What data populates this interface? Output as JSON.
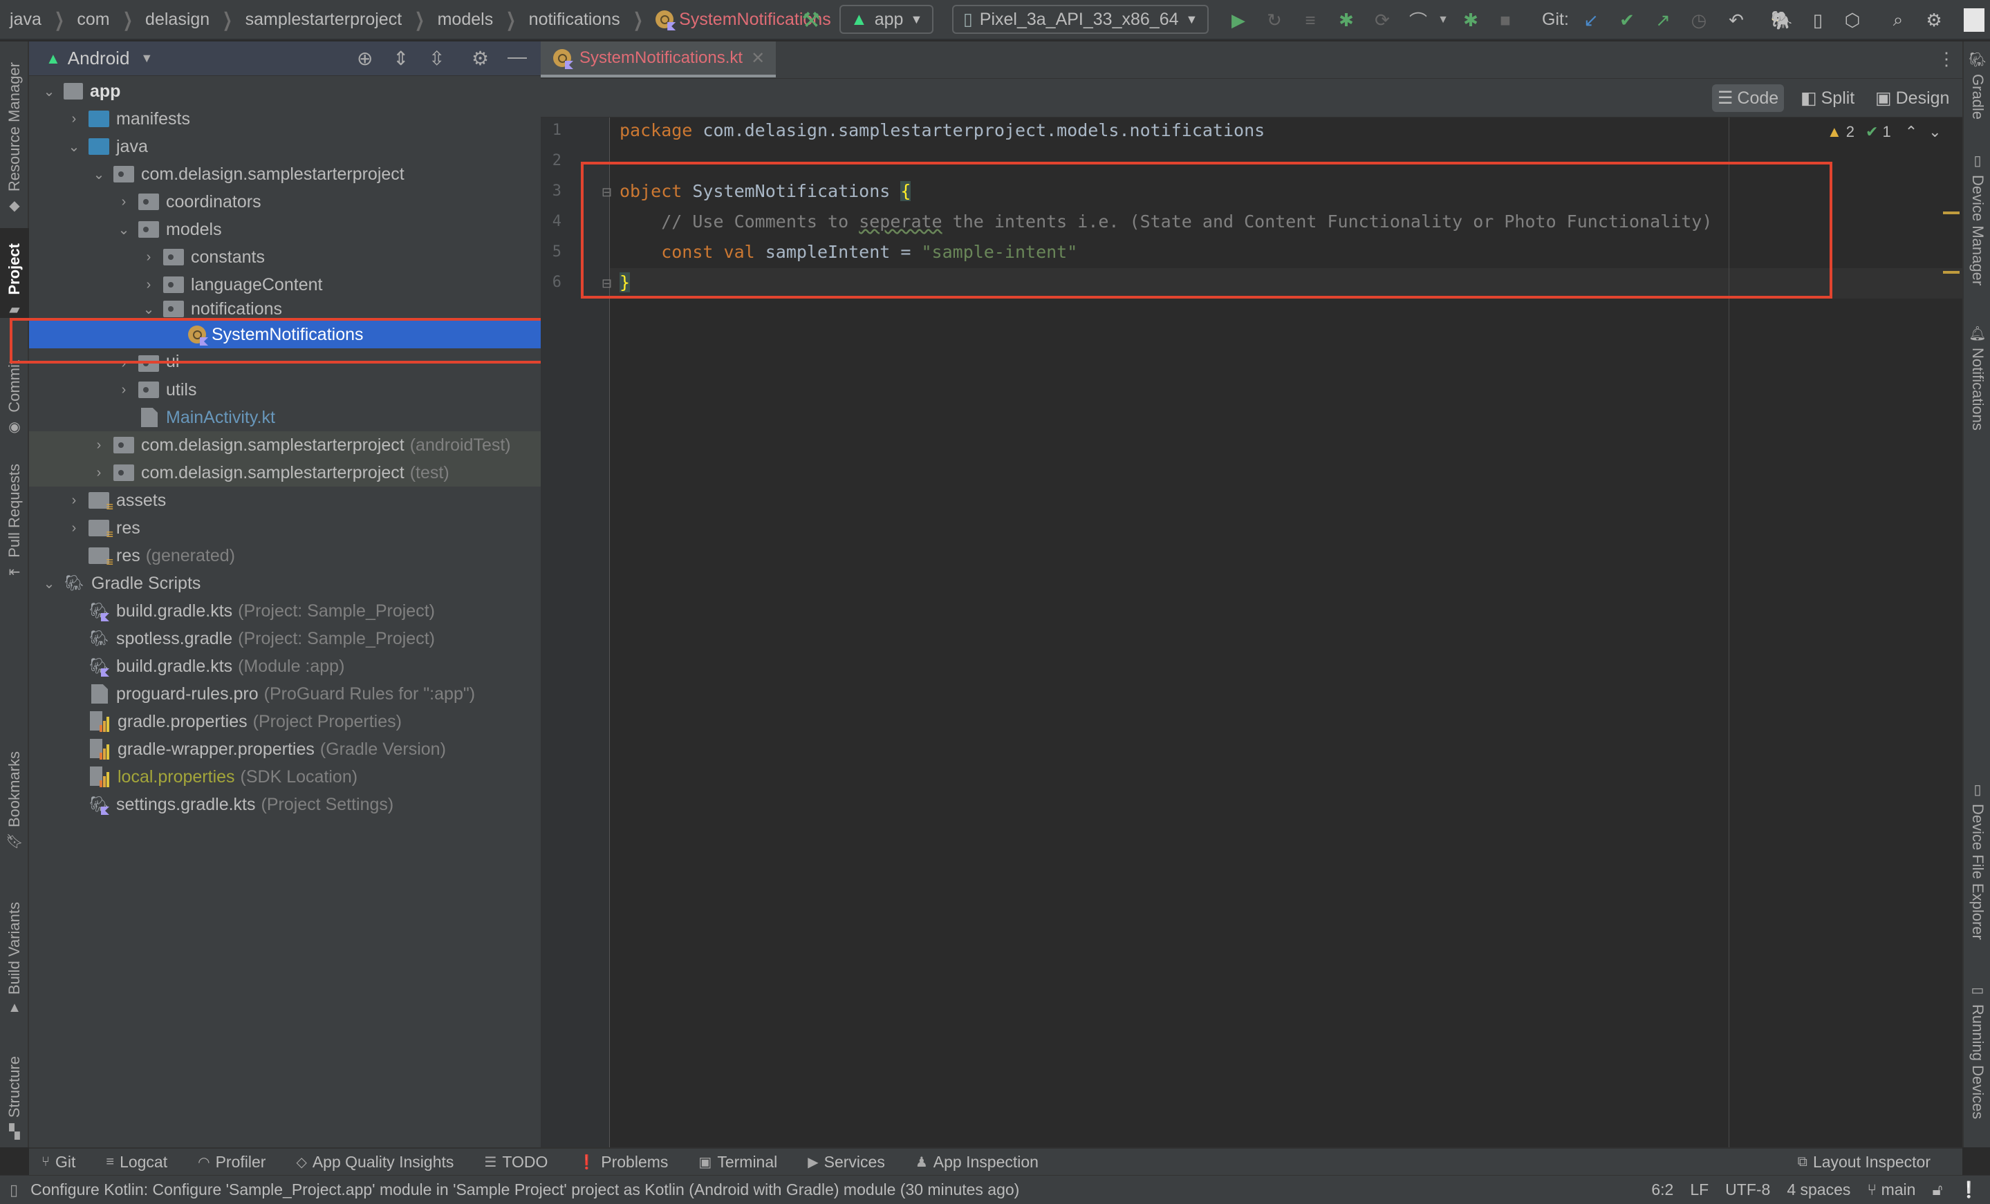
{
  "breadcrumb": {
    "items": [
      "java",
      "com",
      "delasign",
      "samplestarterproject",
      "models",
      "notifications"
    ],
    "current": "SystemNotifications"
  },
  "toolbar": {
    "run_config": "app",
    "device": "Pixel_3a_API_33_x86_64",
    "git_label": "Git:"
  },
  "left_stripe": {
    "tabs": [
      "Resource Manager",
      "Project",
      "Commit",
      "Pull Requests",
      "Bookmarks",
      "Build Variants",
      "Structure"
    ]
  },
  "right_stripe": {
    "tabs": [
      "Gradle",
      "Device Manager",
      "Notifications",
      "Device File Explorer",
      "Running Devices"
    ]
  },
  "project_panel": {
    "view": "Android",
    "tree": [
      {
        "label": "app",
        "hint": ""
      },
      {
        "label": "manifests",
        "hint": ""
      },
      {
        "label": "java",
        "hint": ""
      },
      {
        "label": "com.delasign.samplestarterproject",
        "hint": ""
      },
      {
        "label": "coordinators",
        "hint": ""
      },
      {
        "label": "models",
        "hint": ""
      },
      {
        "label": "constants",
        "hint": ""
      },
      {
        "label": "languageContent",
        "hint": ""
      },
      {
        "label": "notifications",
        "hint": ""
      },
      {
        "label": "SystemNotifications",
        "hint": ""
      },
      {
        "label": "ui",
        "hint": ""
      },
      {
        "label": "utils",
        "hint": ""
      },
      {
        "label": "MainActivity.kt",
        "hint": ""
      },
      {
        "label": "com.delasign.samplestarterproject",
        "hint": "(androidTest)"
      },
      {
        "label": "com.delasign.samplestarterproject",
        "hint": "(test)"
      },
      {
        "label": "assets",
        "hint": ""
      },
      {
        "label": "res",
        "hint": ""
      },
      {
        "label": "res",
        "hint": "(generated)"
      },
      {
        "label": "Gradle Scripts",
        "hint": ""
      },
      {
        "label": "build.gradle.kts",
        "hint": "(Project: Sample_Project)"
      },
      {
        "label": "spotless.gradle",
        "hint": "(Project: Sample_Project)"
      },
      {
        "label": "build.gradle.kts",
        "hint": "(Module :app)"
      },
      {
        "label": "proguard-rules.pro",
        "hint": "(ProGuard Rules for \":app\")"
      },
      {
        "label": "gradle.properties",
        "hint": "(Project Properties)"
      },
      {
        "label": "gradle-wrapper.properties",
        "hint": "(Gradle Version)"
      },
      {
        "label": "local.properties",
        "hint": "(SDK Location)"
      },
      {
        "label": "settings.gradle.kts",
        "hint": "(Project Settings)"
      }
    ]
  },
  "editor": {
    "tab": "SystemNotifications.kt",
    "modes": [
      "Code",
      "Split",
      "Design"
    ],
    "active_mode": "Code",
    "warnings": "2",
    "typos": "1",
    "line_numbers": [
      "1",
      "2",
      "3",
      "4",
      "5",
      "6"
    ],
    "code": {
      "l1_kw": "package",
      "l1_rest": " com.delasign.samplestarterproject.models.notifications",
      "l3_kw": "object",
      "l3_name": " SystemNotifications ",
      "l3_brace": "{",
      "l4_a": "    // Use Comments to ",
      "l4_typo": "seperate",
      "l4_b": " the intents i.e. (State and Content Functionality or Photo Functionality)",
      "l5_kw": "    const val",
      "l5_name": " sampleIntent = ",
      "l5_str": "\"sample-intent\"",
      "l6_brace": "}"
    }
  },
  "tool_windows": [
    "Git",
    "Logcat",
    "Profiler",
    "App Quality Insights",
    "TODO",
    "Problems",
    "Terminal",
    "Services",
    "App Inspection"
  ],
  "layout_inspector": "Layout Inspector",
  "status": {
    "message": "Configure Kotlin: Configure 'Sample_Project.app' module in 'Sample Project' project as Kotlin (Android with Gradle) module (30 minutes ago)",
    "position": "6:2",
    "line_sep": "LF",
    "encoding": "UTF-8",
    "indent": "4 spaces",
    "branch": "main"
  },
  "colors": {
    "selection": "#2f65ca",
    "highlight_box": "#e2442f",
    "keyword": "#cc7832",
    "string": "#6a8759"
  }
}
